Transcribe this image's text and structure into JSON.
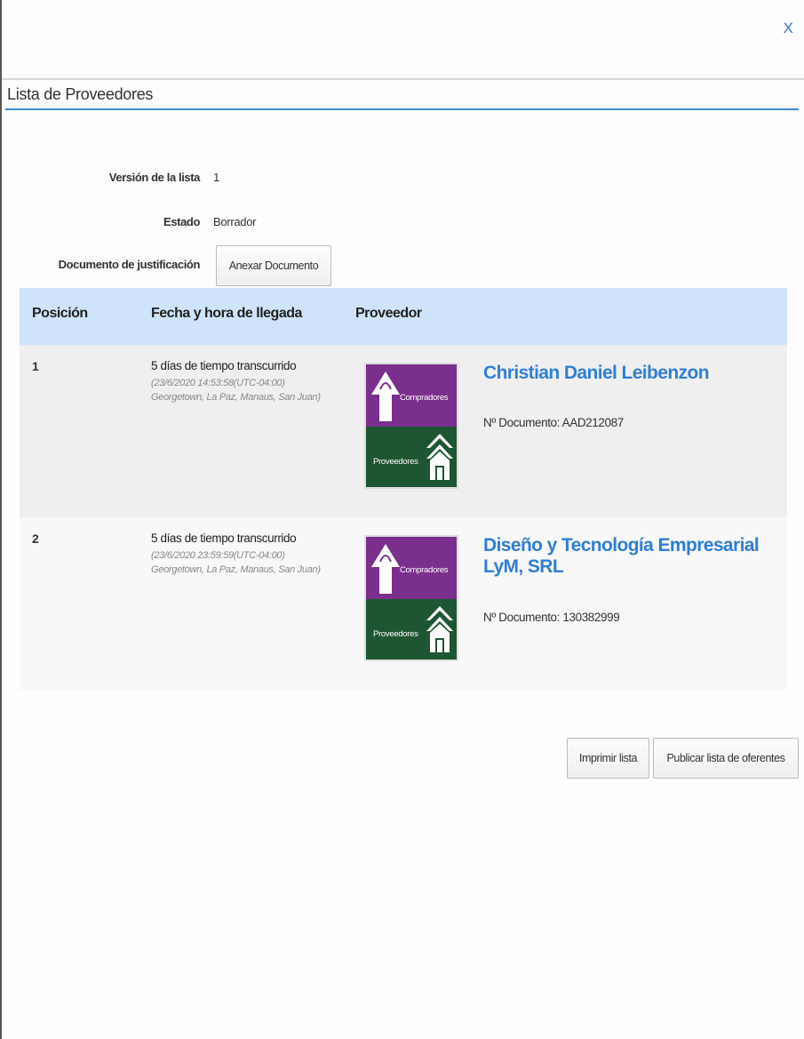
{
  "dialog": {
    "close_label": "X",
    "title": "Lista de Proveedores"
  },
  "info": {
    "version_label": "Versión de la lista",
    "version_value": "1",
    "status_label": "Estado",
    "status_value": "Borrador",
    "justification_label": "Documento de justificación",
    "attach_button": "Anexar Documento"
  },
  "table": {
    "headers": [
      "Posición",
      "Fecha y hora de llegada",
      "Proveedor"
    ],
    "rows": [
      {
        "position": "1",
        "elapsed": "5 días de tiempo transcurrido",
        "timestamp": "(23/6/2020 14:53:58(UTC-04:00)",
        "timezone": "Georgetown, La Paz, Manaus, San Juan)",
        "logo_top_label": "Compradores",
        "logo_bottom_label": "Proveedores",
        "supplier_name": "Christian Daniel Leibenzon",
        "document": "Nº Documento: AAD212087"
      },
      {
        "position": "2",
        "elapsed": "5 días de tiempo transcurrido",
        "timestamp": "(23/6/2020 23:59:59(UTC-04:00)",
        "timezone": "Georgetown, La Paz, Manaus, San Juan)",
        "logo_top_label": "Compradores",
        "logo_bottom_label": "Proveedores",
        "supplier_name": "Diseño y Tecnología Empresarial LyM, SRL",
        "document": "Nº Documento: 130382999"
      }
    ]
  },
  "actions": {
    "print_button": "Imprimir lista",
    "publish_button": "Publicar lista de oferentes"
  },
  "colors": {
    "accent": "#2f7fd6",
    "header_bg": "#cfe4fa",
    "logo_purple": "#7b2f8d",
    "logo_green": "#1e5533"
  }
}
